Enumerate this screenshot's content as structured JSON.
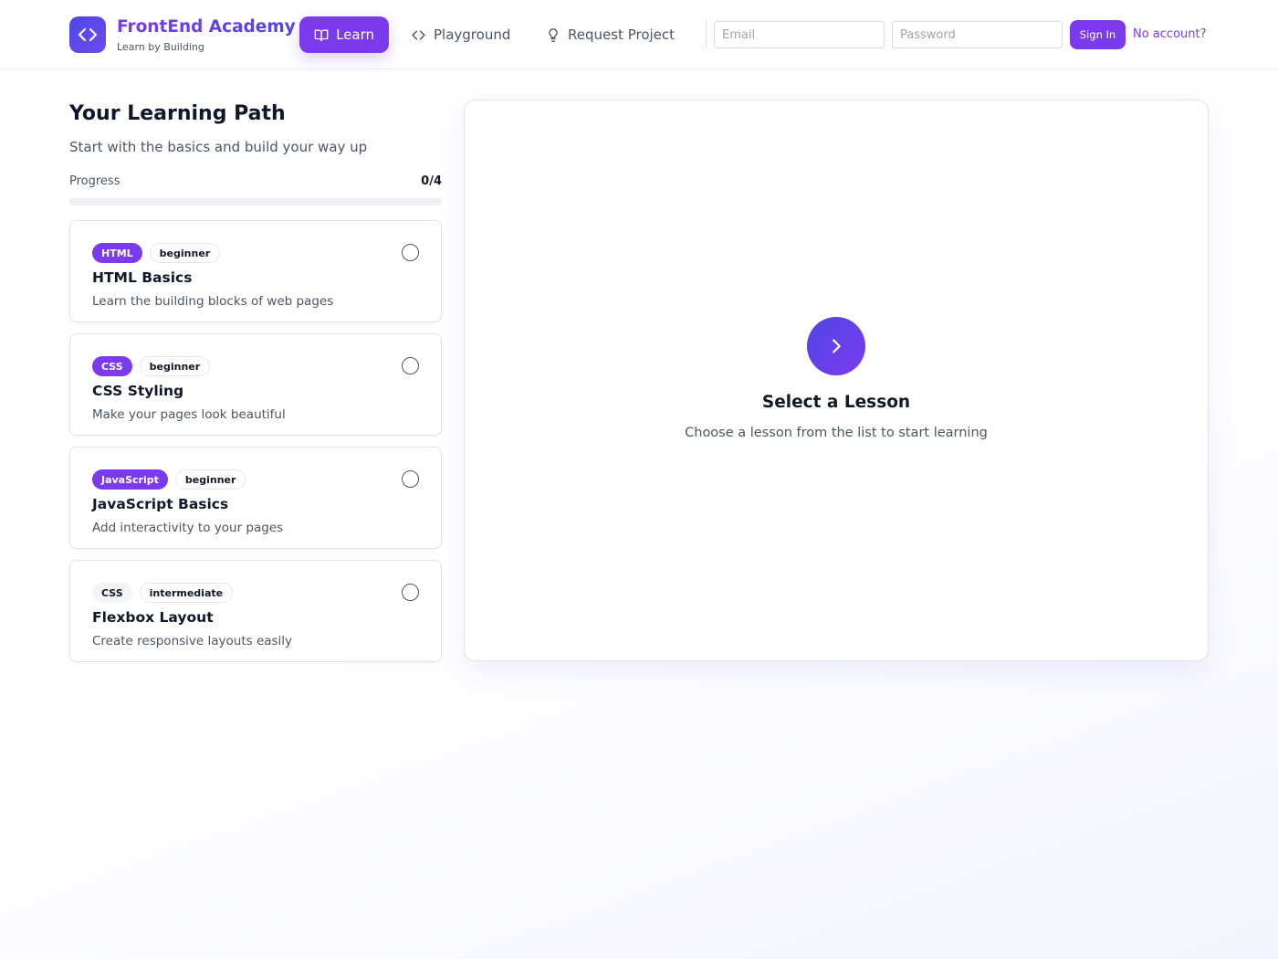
{
  "header": {
    "brand_title": "FrontEnd Academy",
    "brand_subtitle": "Learn by Building",
    "logo_icon": "code-brackets-icon",
    "nav": [
      {
        "label": "Learn",
        "icon": "book-open-icon",
        "active": true
      },
      {
        "label": "Playground",
        "icon": "code-icon",
        "active": false
      },
      {
        "label": "Request Project",
        "icon": "lightbulb-icon",
        "active": false
      }
    ],
    "email_placeholder": "Email",
    "password_placeholder": "Password",
    "signin_label": "Sign In",
    "no_account_label": "No account?"
  },
  "learning_path": {
    "title": "Your Learning Path",
    "subtitle": "Start with the basics and build your way up",
    "progress_label": "Progress",
    "progress_count": "0/4",
    "progress_fraction": 0,
    "lessons": [
      {
        "topic": "HTML",
        "topic_style": "filled",
        "level": "beginner",
        "title": "HTML Basics",
        "description": "Learn the building blocks of web pages",
        "completed": false
      },
      {
        "topic": "CSS",
        "topic_style": "filled",
        "level": "beginner",
        "title": "CSS Styling",
        "description": "Make your pages look beautiful",
        "completed": false
      },
      {
        "topic": "JavaScript",
        "topic_style": "filled",
        "level": "beginner",
        "title": "JavaScript Basics",
        "description": "Add interactivity to your pages",
        "completed": false
      },
      {
        "topic": "CSS",
        "topic_style": "plain",
        "level": "intermediate",
        "title": "Flexbox Layout",
        "description": "Create responsive layouts easily",
        "completed": false
      }
    ]
  },
  "viewer": {
    "icon": "chevron-right-icon",
    "title": "Select a Lesson",
    "subtitle": "Choose a lesson from the list to start learning"
  },
  "colors": {
    "accent": "#7c3aed",
    "accent_secondary": "#4f46e5"
  }
}
